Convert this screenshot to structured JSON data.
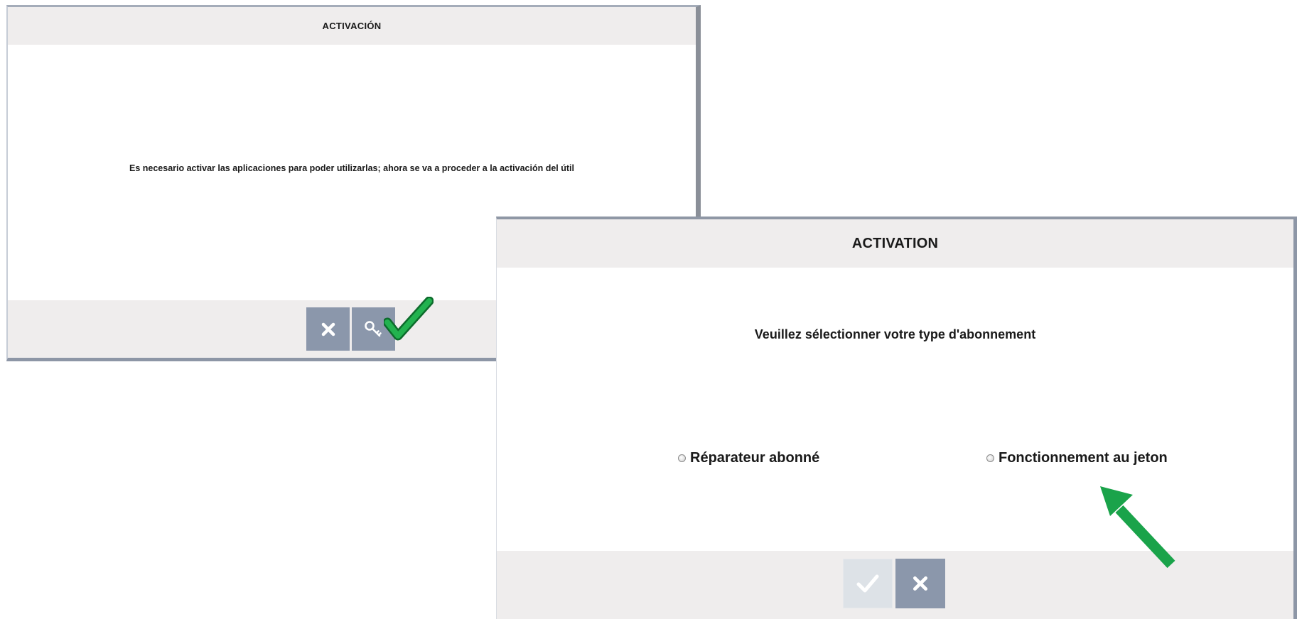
{
  "dialog_es": {
    "title": "ACTIVACIÓN",
    "message": "Es necesario activar las aplicaciones para poder utilizarlas; ahora se va a proceder a la activación del útil",
    "buttons": [
      {
        "name": "cancel",
        "icon": "close-icon"
      },
      {
        "name": "activate",
        "icon": "key-icon"
      }
    ]
  },
  "dialog_fr": {
    "title": "ACTIVATION",
    "message": "Veuillez sélectionner votre type d'abonnement",
    "options": [
      {
        "label": "Réparateur abonné",
        "selected": false
      },
      {
        "label": "Fonctionnement au jeton",
        "selected": false
      }
    ],
    "buttons": [
      {
        "name": "confirm",
        "icon": "check-icon",
        "enabled": false
      },
      {
        "name": "cancel",
        "icon": "close-icon",
        "enabled": true
      }
    ]
  },
  "annotations": {
    "checkmark_icon": "green-checkmark-icon",
    "arrow_icon": "green-arrow-icon",
    "accent_color": "#1aa34a"
  },
  "colors": {
    "header_bg": "#efeded",
    "button_bg": "#8b97ab",
    "button_disabled_bg": "#dde2e7",
    "border": "#8d96a6"
  }
}
